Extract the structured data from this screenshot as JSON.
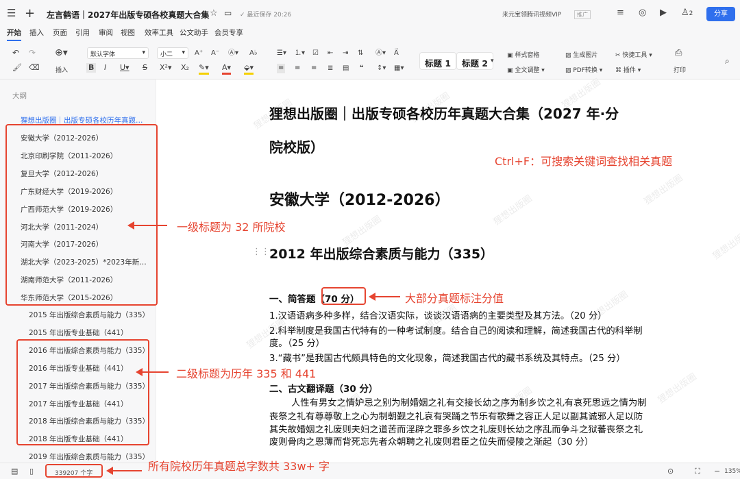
{
  "titlebar": {
    "home_icon": "grid-icon",
    "new_tab": "+",
    "title": "左言鹤语｜2027年出版专硕各校真题大合集",
    "star_icon": "star-icon",
    "folder_icon": "folder-icon",
    "save_status": "最近保存 20:26",
    "vip_text": "来元宝领腾讯视频VIP",
    "promo": "推广",
    "user_count": "2",
    "share_label": "分享"
  },
  "menu": [
    "开始",
    "插入",
    "页面",
    "引用",
    "审阅",
    "视图",
    "效率工具",
    "公文助手",
    "会员专享"
  ],
  "ribbon": {
    "insert_label": "插入",
    "font_name": "默认字体",
    "font_size": "小二",
    "heading1": "标题 1",
    "heading2": "标题 2",
    "style_window": "样式窗格",
    "full_adjust": "全文调整",
    "gen_image": "生成图片",
    "pdf_convert": "PDF转换",
    "quick_tools": "快捷工具",
    "plugins": "插件",
    "print_label": "打印"
  },
  "sidebar": {
    "title": "大纲",
    "root": "狸想出版圈｜出版专硕各校历年真题大...",
    "schools": [
      "安徽大学（2012-2026）",
      "北京印刷学院（2011-2026）",
      "复旦大学（2012-2026）",
      "广东财经大学（2019-2026）",
      "广西师范大学（2019-2026）",
      "河北大学（2011-2024）",
      "河南大学（2017-2026）",
      "湖北大学（2023-2025）*2023年新增...",
      "湖南师范大学（2011-2026）",
      "华东师范大学（2015-2026）"
    ],
    "sub": [
      "2015 年出版综合素质与能力（335）",
      "2015 年出版专业基础（441）",
      "2016 年出版综合素质与能力（335）",
      "2016 年出版专业基础（441）",
      "2017 年出版综合素质与能力（335）",
      "2017 年出版专业基础（441）",
      "2018 年出版综合素质与能力（335）",
      "2018 年出版专业基础（441）",
      "2019 年出版综合素质与能力（335）"
    ]
  },
  "doc": {
    "title_line1": "狸想出版圈｜出版专硕各校历年真题大合集（2027 年·分",
    "title_line2": "院校版）",
    "h1": "安徽大学（2012-2026）",
    "h2": "2012 年出版综合素质与能力（335）",
    "sec1_pre": "一、简答题",
    "sec1_score": "（70 分）",
    "q1": "1.汉语语病多种多样，结合汉语实际，谈谈汉语语病的主要类型及其方法。（20 分）",
    "q2a": "2.科举制度是我国古代特有的一种考试制度。结合自己的阅读和理解，简述我国古代的科举制",
    "q2b": "度。（25 分）",
    "q3": "3.“藏书”是我国古代颇具特色的文化现象，简述我国古代的藏书系统及其特点。（25 分）",
    "sec2": "二、古文翻译题（30 分）",
    "p1": "人性有男女之情妒忌之别为制婚姻之礼有交接长幼之序为制乡饮之礼有哀死思远之情为制",
    "p2": "丧祭之礼有尊尊敬上之心为制朝觐之礼哀有哭踊之节乐有歌舞之容正人足以副其诚邪人足以防",
    "p3": "其失故婚姻之礼废则夫妇之道苦而淫辟之罪多乡饮之礼废则长幼之序乱而争斗之狱蕃丧祭之礼",
    "p4": "废则骨肉之恩薄而背死忘先者众朝聘之礼废则君臣之位失而侵陵之渐起（30 分）",
    "watermark": "狸想出版圈"
  },
  "annotations": {
    "search_hint": "Ctrl+F：可搜索关键词查找相关真题",
    "level1": "一级标题为 32 所院校",
    "score_note": "大部分真题标注分值",
    "level2": "二级标题为历年 335 和 441",
    "word_count_note": "所有院校历年真题总字数共 33w+ 字"
  },
  "status": {
    "word_count": "339207 个字",
    "zoom": "135%"
  },
  "colors": {
    "accent": "#2f6fed",
    "annotation": "#e64430"
  }
}
